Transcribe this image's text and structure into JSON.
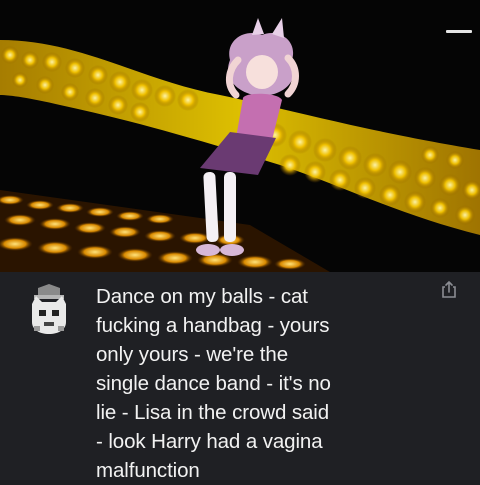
{
  "video": {
    "frame_icon": "dancing-anime-character",
    "accent_color": "#f2c200"
  },
  "comment": {
    "avatar_icon": "cat-avatar-icon",
    "text": "Dance on my balls - cat\nfucking a handbag - yours\nonly yours - we're the\nsingle dance band - it's no\nlie - Lisa in the crowd said\n- look Harry had a vagina\nmalfunction",
    "share_icon": "share-icon"
  }
}
